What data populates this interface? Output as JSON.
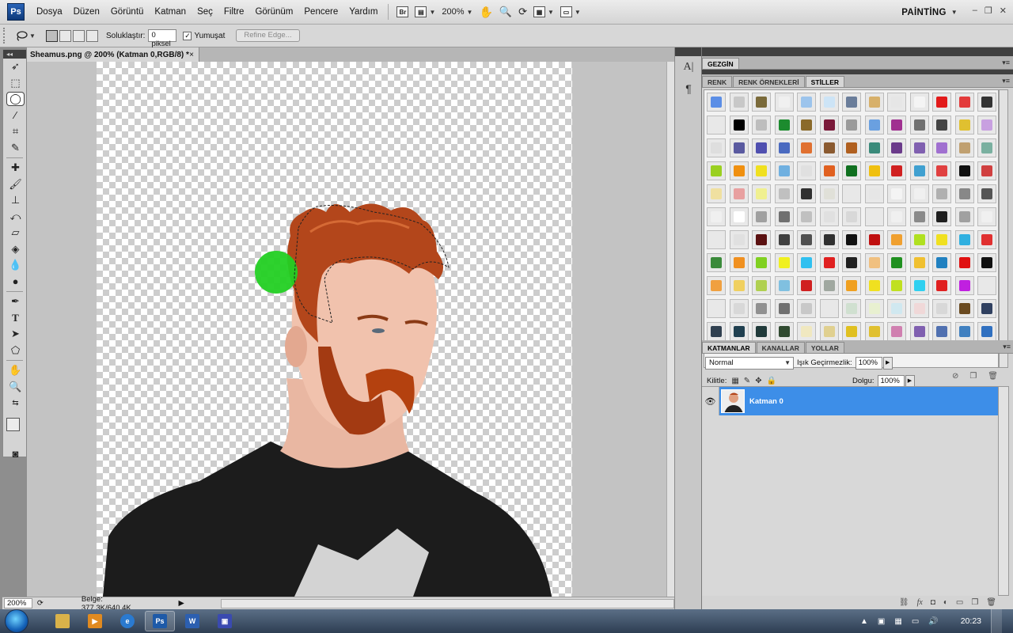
{
  "app": {
    "logo": "Ps"
  },
  "menu": [
    "Dosya",
    "Düzen",
    "Görüntü",
    "Katman",
    "Seç",
    "Filtre",
    "Görünüm",
    "Pencere",
    "Yardım"
  ],
  "appbar": {
    "bridge_label": "Br",
    "zoom": "200%",
    "workspace": "PAİNTİNG"
  },
  "options": {
    "feather_label": "Soluklaştır:",
    "feather_value": "0 piksel",
    "antialias_label": "Yumuşat",
    "antialias_checked": true,
    "refine_edge": "Refine Edge..."
  },
  "document": {
    "tab_title": "Sheamus.png @ 200% (Katman 0,RGB/8) *",
    "close": "×",
    "zoom_field": "200%",
    "doc_info": "Belge: 377,3K/640,4K"
  },
  "panels": {
    "navigator_tab": "GEZGİN",
    "tabs": [
      "RENK",
      "RENK ÖRNEKLERİ",
      "STİLLER"
    ],
    "active_tab": "STİLLER",
    "swatch_colors": [
      [
        "#5b8ee6",
        "#c8c8c8",
        "#7a6a3a",
        "#f0f0f0",
        "#9cc4ec",
        "#cde4f6",
        "#6a7d9a",
        "#d7b06a",
        "#e6e6e6",
        "#f4f4f4",
        "#e21a1a",
        "#e33b3b",
        "#333333"
      ],
      [
        "#e8e8e8",
        "#000000",
        "#bdbdbd",
        "#1c8b2e",
        "#8a6a2a",
        "#7a1a3a",
        "#9a9a9a",
        "#6aa0e0",
        "#a03090",
        "#707070",
        "#444444",
        "#e0c030",
        "#c8a0e0"
      ],
      [
        "#dedede",
        "#5a5aa0",
        "#5050b0",
        "#4a6ac0",
        "#e07030",
        "#8a5a30",
        "#b06020",
        "#3a8a7a",
        "#6a3a8a",
        "#8060b0",
        "#a070d0",
        "#c0a070",
        "#7ab0a0"
      ],
      [
        "#9ad020",
        "#f09010",
        "#f0e020",
        "#70b0e0",
        "#e0e0e0",
        "#e06020",
        "#107020",
        "#f0c010",
        "#d02020",
        "#40a0d0",
        "#e04040",
        "#101010",
        "#d04040"
      ],
      [
        "#f0e0a0",
        "#e8a0a0",
        "#f0f090",
        "#c0c0c0",
        "#303030",
        "#e0e0d8",
        "#e8e8e8",
        "#e6e6e6",
        "#f4f4f4",
        "#f0f0f0",
        "#b0b0b0",
        "#888888",
        "#555555"
      ],
      [
        "#f0f0f0",
        "#ffffff",
        "#a0a0a0",
        "#707070",
        "#c0c0c0",
        "#e0e0e0",
        "#d8d8d8",
        "#e8e8e8",
        "#f0f0f0",
        "#8a8a8a",
        "#202020",
        "#a0a0a0",
        "#f0f0f0"
      ],
      [
        "#e8e8e8",
        "#e0e0e0",
        "#5a1010",
        "#404040",
        "#505050",
        "#303030",
        "#101010",
        "#c01010",
        "#f0a030",
        "#b0e020",
        "#f0e020",
        "#30b0e0",
        "#e03030"
      ],
      [
        "#3a8a3a",
        "#f09020",
        "#80d020",
        "#f0f020",
        "#30c0f0",
        "#e02020",
        "#202020",
        "#f0c080",
        "#209020",
        "#f0c030",
        "#2080c0",
        "#e01010",
        "#101010"
      ],
      [
        "#f0a040",
        "#f0d060",
        "#b0d050",
        "#80c0e0",
        "#d02020",
        "#a0a8a0",
        "#f0a020",
        "#f0e020",
        "#c0e020",
        "#30d0f0",
        "#e02020",
        "#c020e0",
        "#e8e8e8"
      ],
      [
        "#e8e8e8",
        "#d8d8d8",
        "#909090",
        "#707070",
        "#c8c8c8",
        "#e8e8e8",
        "#d0e0d0",
        "#e8f0d0",
        "#d0e8f0",
        "#f0d8d8",
        "#d8d8d8",
        "#6a4a20",
        "#304060"
      ],
      [
        "#304050",
        "#204050",
        "#203a3a",
        "#304a30",
        "#f0e8c0",
        "#e0d090",
        "#e0c020",
        "#e0c030",
        "#d080b0",
        "#8060b0",
        "#5070b0",
        "#4080c0",
        "#3070c0"
      ]
    ],
    "layers_tabs": [
      "KATMANLAR",
      "KANALLAR",
      "YOLLAR"
    ],
    "active_layers_tab": "KATMANLAR",
    "blend_mode": "Normal",
    "opacity_label": "Işık Geçirmezlik:",
    "opacity_value": "100%",
    "lock_label": "Kilitle:",
    "fill_label": "Dolgu:",
    "fill_value": "100%",
    "layer_name": "Katman 0",
    "layer_footer_icons": [
      "link-icon",
      "fx-icon",
      "mask-icon",
      "adjustment-icon",
      "folder-icon",
      "new-layer-icon",
      "trash-icon"
    ]
  },
  "taskbar": {
    "clock": "20:23"
  }
}
